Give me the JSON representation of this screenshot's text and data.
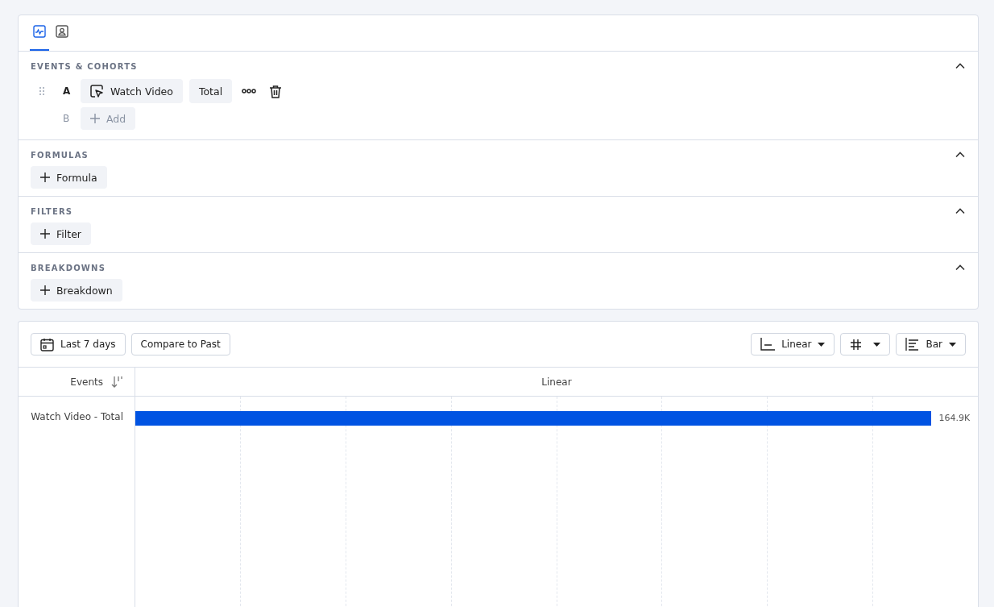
{
  "tabs": [
    {
      "selected": true
    },
    {
      "selected": false
    }
  ],
  "sections": [
    {
      "title": "EVENTS & COHORTS",
      "expanded": true,
      "kind": "events",
      "rows": [
        {
          "letter": "A",
          "kind": "event",
          "event": "Watch Video",
          "measure": "Total"
        },
        {
          "letter": "B",
          "kind": "add",
          "label": "Add"
        }
      ]
    },
    {
      "title": "FORMULAS",
      "expanded": true,
      "kind": "button",
      "button": "Formula"
    },
    {
      "title": "FILTERS",
      "expanded": true,
      "kind": "button",
      "button": "Filter"
    },
    {
      "title": "BREAKDOWNS",
      "expanded": true,
      "kind": "button",
      "button": "Breakdown"
    }
  ],
  "toolbar": {
    "date_range": "Last 7 days",
    "compare": "Compare to Past",
    "scale": "Linear",
    "chart_type": "Bar"
  },
  "table": {
    "column_header": "Events",
    "scale_header": "Linear",
    "rows": [
      {
        "label": "Watch Video - Total",
        "level": 0.945,
        "reading": "164.9K"
      }
    ]
  }
}
